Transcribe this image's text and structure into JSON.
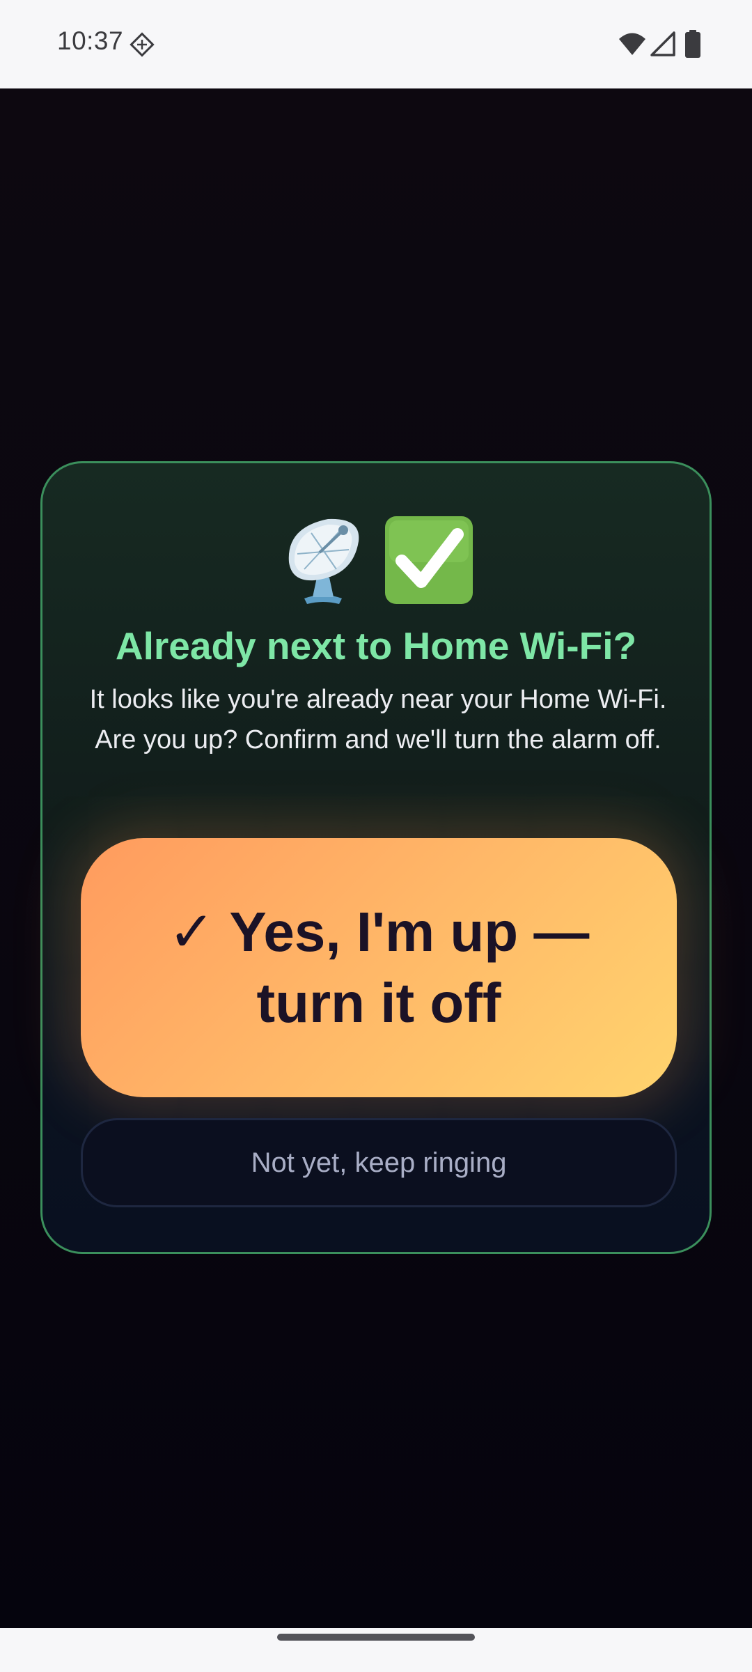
{
  "status_bar": {
    "time": "10:37",
    "icons": [
      "diamond-notification-icon",
      "wifi-icon",
      "cellular-signal-icon",
      "battery-icon"
    ]
  },
  "dialog": {
    "icons": [
      "satellite-antenna-emoji",
      "check-mark-button-emoji"
    ],
    "title": "Already next to Home Wi-Fi?",
    "body": "It looks like you're already near your Home Wi-Fi. Are you up? Confirm and we'll turn the alarm off.",
    "confirm_label": "✓ Yes, I'm up — turn it off",
    "dismiss_label": "Not yet, keep ringing"
  },
  "colors": {
    "title": "#7ee6a6",
    "card_border": "#3b8f5c",
    "confirm_gradient_start": "#ff9b5e",
    "confirm_gradient_end": "#ffd46e",
    "background": "#07050d"
  }
}
